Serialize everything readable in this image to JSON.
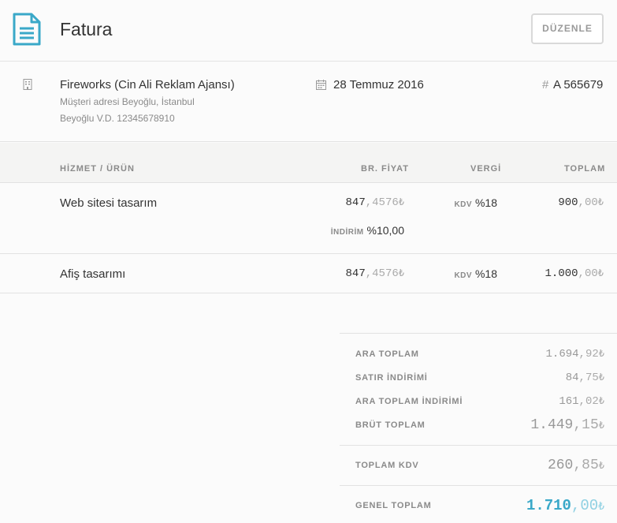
{
  "header": {
    "title": "Fatura",
    "edit_label": "DÜZENLE",
    "icon": "document-icon"
  },
  "client": {
    "name": "Fireworks (Cin Ali Reklam Ajansı)",
    "address": "Müşteri adresi Beyoğlu, İstanbul",
    "tax_info": "Beyoğlu V.D. 12345678910",
    "date": "28 Temmuz 2016",
    "hash": "#",
    "invoice_no": "A 565679"
  },
  "table": {
    "headers": {
      "item": "HİZMET / ÜRÜN",
      "unit_price": "BR. FİYAT",
      "tax": "VERGİ",
      "total": "TOPLAM"
    },
    "rows": [
      {
        "name": "Web sitesi tasarım",
        "price_int": "847",
        "price_frac": ",4576",
        "price_cur": "₺",
        "tax_label": "KDV",
        "tax_value": "%18",
        "total_int": "900",
        "total_frac": ",00",
        "total_cur": "₺",
        "discount_label": "İNDİRİM",
        "discount_value": "%10,00"
      },
      {
        "name": "Afiş tasarımı",
        "price_int": "847",
        "price_frac": ",4576",
        "price_cur": "₺",
        "tax_label": "KDV",
        "tax_value": "%18",
        "total_int": "1.000",
        "total_frac": ",00",
        "total_cur": "₺"
      }
    ]
  },
  "totals": {
    "subtotal": {
      "label": "ARA TOPLAM",
      "int": "1.694",
      "frac": ",92",
      "cur": "₺"
    },
    "line_discount": {
      "label": "SATIR İNDİRİMİ",
      "int": "84",
      "frac": ",75",
      "cur": "₺"
    },
    "subtotal_discount": {
      "label": "ARA TOPLAM İNDİRİMİ",
      "int": "161",
      "frac": ",02",
      "cur": "₺"
    },
    "gross": {
      "label": "BRÜT TOPLAM",
      "int": "1.449",
      "frac": ",15",
      "cur": "₺"
    },
    "vat": {
      "label": "TOPLAM KDV",
      "int": "260",
      "frac": ",85",
      "cur": "₺"
    },
    "grand": {
      "label": "GENEL TOPLAM",
      "int": "1.710",
      "frac": ",00",
      "cur": "₺"
    }
  },
  "colors": {
    "accent": "#3aa8c8",
    "border": "#e2e2e2",
    "muted": "#8a8a8a"
  }
}
